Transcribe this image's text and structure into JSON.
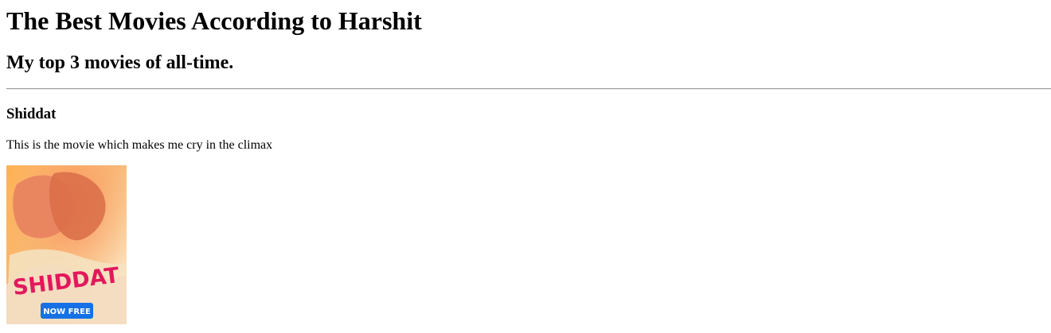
{
  "page": {
    "title": "The Best Movies According to Harshit",
    "subtitle": "My top 3 movies of all-time."
  },
  "movies": [
    {
      "name": "Shiddat",
      "description": "This is the movie which makes me cry in the climax",
      "poster": {
        "logo_text": "SHIDDAT",
        "badge_text": "NOW FREE",
        "colors": {
          "background_light": "#fff3e1",
          "background_warm": "#f6b25a",
          "figure": "#e47d4c",
          "logo": "#e3185c",
          "badge": "#1671e6"
        }
      }
    }
  ]
}
